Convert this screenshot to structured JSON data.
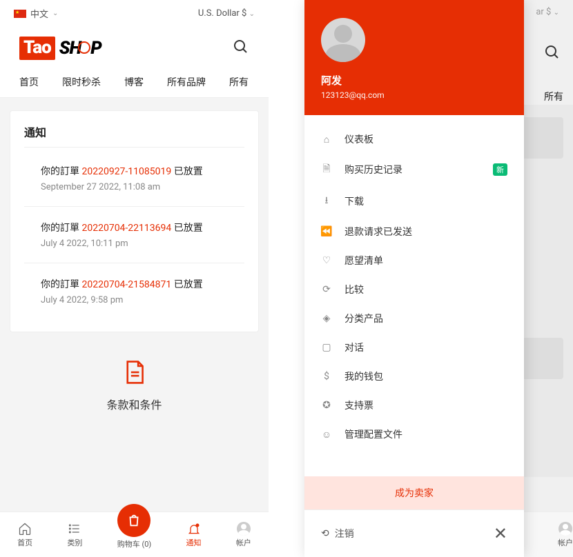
{
  "top": {
    "lang": "中文",
    "currency": "U.S. Dollar $"
  },
  "logo": {
    "part1": "Tao",
    "part2": "SH",
    "part3": "P"
  },
  "nav": [
    "首页",
    "限时秒杀",
    "博客",
    "所有品牌",
    "所有"
  ],
  "card_title": "通知",
  "notifs": [
    {
      "pre": "你的訂單 ",
      "ord": "20220927-11085019",
      "post": " 已放置",
      "date": "September 27 2022, 11:08 am"
    },
    {
      "pre": "你的訂單 ",
      "ord": "20220704-22113694",
      "post": " 已放置",
      "date": "July 4 2022, 10:11 pm"
    },
    {
      "pre": "你的訂單 ",
      "ord": "20220704-21584871",
      "post": " 已放置",
      "date": "July 4 2022, 9:58 pm"
    }
  ],
  "terms": "条款和条件",
  "tabs": {
    "home": "首页",
    "cat": "类别",
    "cart": "购物车 (0)",
    "notif": "通知",
    "acct": "帐户"
  },
  "drawer": {
    "name": "阿发",
    "email": "123123@qq.com",
    "items": [
      {
        "label": "仪表板"
      },
      {
        "label": "购买历史记录",
        "badge": "新"
      },
      {
        "label": "下载"
      },
      {
        "label": "退款请求已发送"
      },
      {
        "label": "愿望清单"
      },
      {
        "label": "比较"
      },
      {
        "label": "分类产品"
      },
      {
        "label": "对话"
      },
      {
        "label": "我的钱包"
      },
      {
        "label": "支持票"
      },
      {
        "label": "管理配置文件"
      }
    ],
    "seller": "成为卖家",
    "logout": "注销"
  },
  "right_peek": {
    "currency_tail": "ar $",
    "nav_tail": "所有",
    "acct": "帐户"
  }
}
